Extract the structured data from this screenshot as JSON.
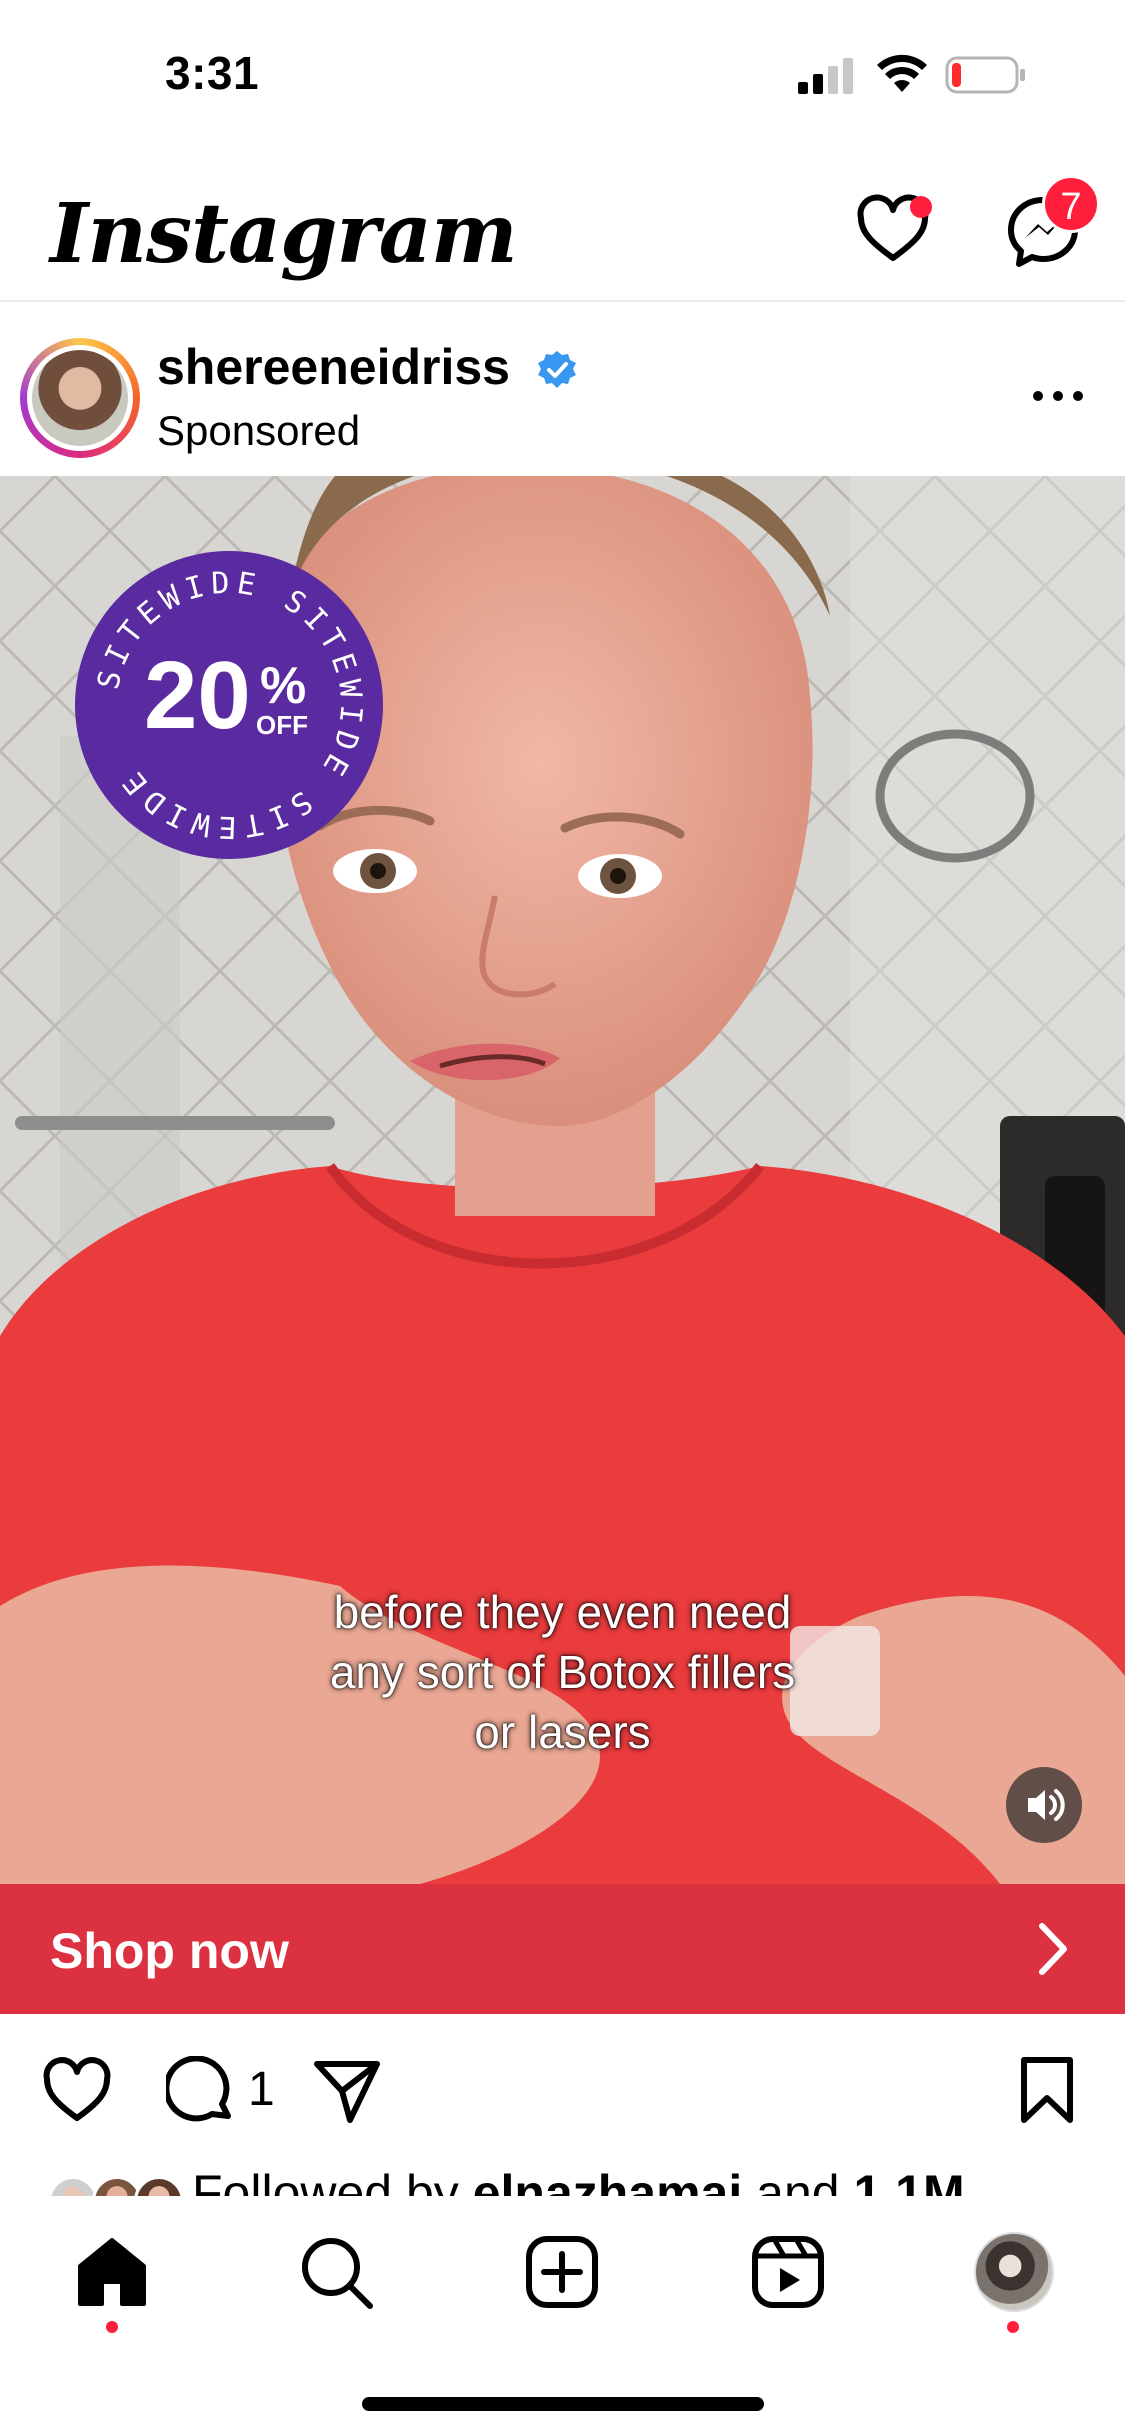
{
  "status_bar": {
    "time": "3:31"
  },
  "header": {
    "logo": "Instagram",
    "messages_badge": "7"
  },
  "post": {
    "username": "shereeneidriss",
    "subtitle": "Sponsored",
    "promo_badge": {
      "ring_text": "SITEWIDE",
      "value": "20",
      "percent": "%",
      "off": "OFF"
    },
    "caption_lines": [
      "before they even need",
      "any sort of Botox fillers",
      "or lasers"
    ],
    "cta_label": "Shop now",
    "comment_count": "1",
    "followed_by": {
      "prefix": "Followed by ",
      "user": "elnazhamai",
      "middle": " and ",
      "count": "1.1M"
    }
  },
  "nav": {
    "items": [
      "home",
      "search",
      "create",
      "reels",
      "profile"
    ]
  },
  "colors": {
    "cta": "#db3140",
    "notification": "#ff1e3c",
    "badge": "#5a2aa0",
    "verified": "#3897f0"
  }
}
